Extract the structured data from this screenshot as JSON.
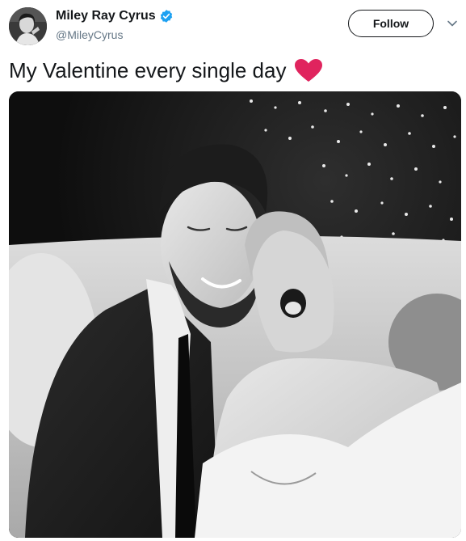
{
  "tweet": {
    "author": {
      "display_name": "Miley Ray Cyrus",
      "handle": "@MileyCyrus",
      "verified": true
    },
    "follow_label": "Follow",
    "text": "My Valentine every single day",
    "emoji": "heart-icon",
    "photo": "black-and-white-couple-photo"
  },
  "colors": {
    "text_primary": "#14171a",
    "text_secondary": "#657786",
    "verified_blue": "#1da1f2",
    "heart_red": "#e0245e"
  }
}
